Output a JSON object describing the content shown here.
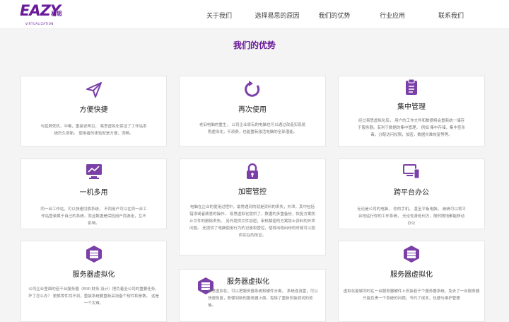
{
  "brand": {
    "logo_text": "EAZY",
    "logo_cn": "易思",
    "logo_tagline": "VIRTUALIZATION"
  },
  "nav": {
    "items": [
      {
        "label": "关于我们"
      },
      {
        "label": "选择易思的原因"
      },
      {
        "label": "我们的优势"
      },
      {
        "label": "行业应用"
      },
      {
        "label": "联系我们"
      }
    ]
  },
  "section": {
    "title": "我们的优势"
  },
  "cards": [
    {
      "title": "方便快捷",
      "icon": "paper-plane-icon",
      "desc": "与蓝屏死机，中毒，重装说再见。 易思虚拟化保证了工作站系统历久常新。 使用者的体验就是方便，流畅。"
    },
    {
      "title": "再次使用",
      "icon": "refresh-icon",
      "desc": "老旧电脑的重生， 公司企业原有的电脑也可以通过改造实现易思虚拟化，不浪费，也能重新激活电脑的全部潜能。"
    },
    {
      "title": "集中管理",
      "icon": "clipboard-icon",
      "desc": "经过易思虚拟化后， 用户的工作文件和数据将会重新统一储存于服务器。有利于数据的集中管理， 例如 集中存储，集中查杀毒，分配访问权限，加密，数据灾难恢复等等。"
    },
    {
      "title": "一机多用",
      "icon": "monitor-chart-icon",
      "desc": "同一台工作站，可以快速切换系统， 不同用户可以在同一台工作站登录属于自己的系统，而且数据是保险用户而游走，互不影响。"
    },
    {
      "title": "加密管控",
      "icon": "lock-icon",
      "desc": "电脑在企业的使用过程中，最常遇到的就是资料的丢失，外泄，其中包括错误或者故意的操作。 易思虚拟化提供了，数据的多重备份，恢复方案防止文件的删除丢失。 另外提供文件加密，审核解密的方案防止资料的外泄问题。 还提供了电脑使用行为的记录和管控，使得出现纠纷的时候可以提供实在的依证。"
    },
    {
      "title": "跨平台办公",
      "icon": "devices-icon",
      "desc": "无论是公司的电脑， 你的手机， 甚至平板电脑， 统统可以将平台地运行你的工作系统， 无论你身处何方，随时随地都能移动办公"
    },
    {
      "title": "服务器虚拟化",
      "icon": "server-icon",
      "desc": "公司企业里面的若干台服务器（ERP,财务,设计）把负着全公司的重要任务，坏了怎么办？ 更换零件找不到，重装系统要重新采设备个软件和参数。 这是一个灾难。"
    },
    {
      "title": "服务器虚拟化",
      "icon": "server-icon",
      "desc": "易思虚拟化，可以把服务器系统和硬件分离， 系统连设置，可以快速恢复，即便到新的服务器上面，免除了重新安装调试的烦恼。"
    },
    {
      "title": "服务器虚拟化",
      "icon": "server-icon",
      "desc": "虚拟化能够同时在一台服务器硬件上安装若干个服务器系统，免去了一台服务器只能负责一个系统的问题。节约了成本，也便与维护管理"
    }
  ],
  "colors": {
    "accent": "#6a1b9a",
    "icon": "#7b3fa8",
    "background": "#f4f4f4"
  }
}
